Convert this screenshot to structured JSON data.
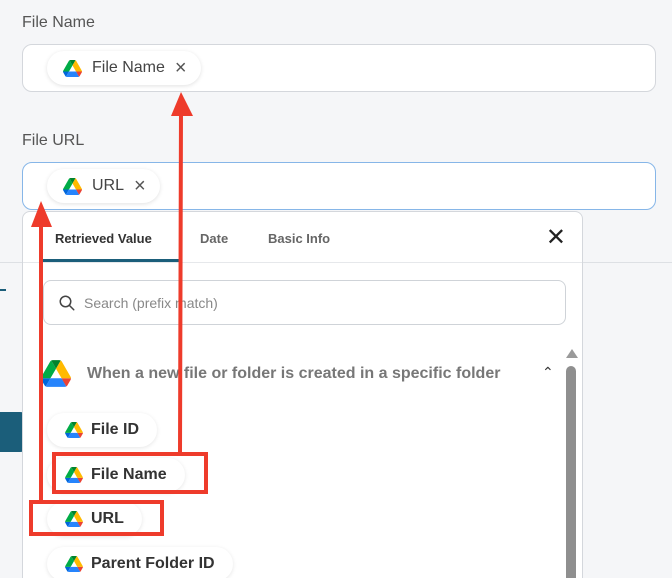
{
  "fields": {
    "file_name": {
      "label": "File Name",
      "chip_label": "File Name"
    },
    "file_url": {
      "label": "File URL",
      "chip_label": "URL"
    }
  },
  "popup": {
    "tabs": [
      {
        "label": "Retrieved Value",
        "active": true
      },
      {
        "label": "Date",
        "active": false
      },
      {
        "label": "Basic Info",
        "active": false
      }
    ],
    "search_placeholder": "Search (prefix match)",
    "group": {
      "title": "When a new file or folder is created in a specific folder",
      "items": [
        {
          "label": "File ID"
        },
        {
          "label": "File Name"
        },
        {
          "label": "URL"
        },
        {
          "label": "Parent Folder ID"
        }
      ]
    }
  },
  "icons": {
    "drive": "google-drive-icon",
    "remove": "close-icon",
    "search": "search-icon",
    "collapse": "chevron-up-icon"
  },
  "colors": {
    "accent": "#1b5e7a",
    "annotation": "#ee3b2b",
    "drive_green": "#1fa463",
    "drive_yellow": "#ffd04b",
    "drive_blue": "#4688f4"
  }
}
